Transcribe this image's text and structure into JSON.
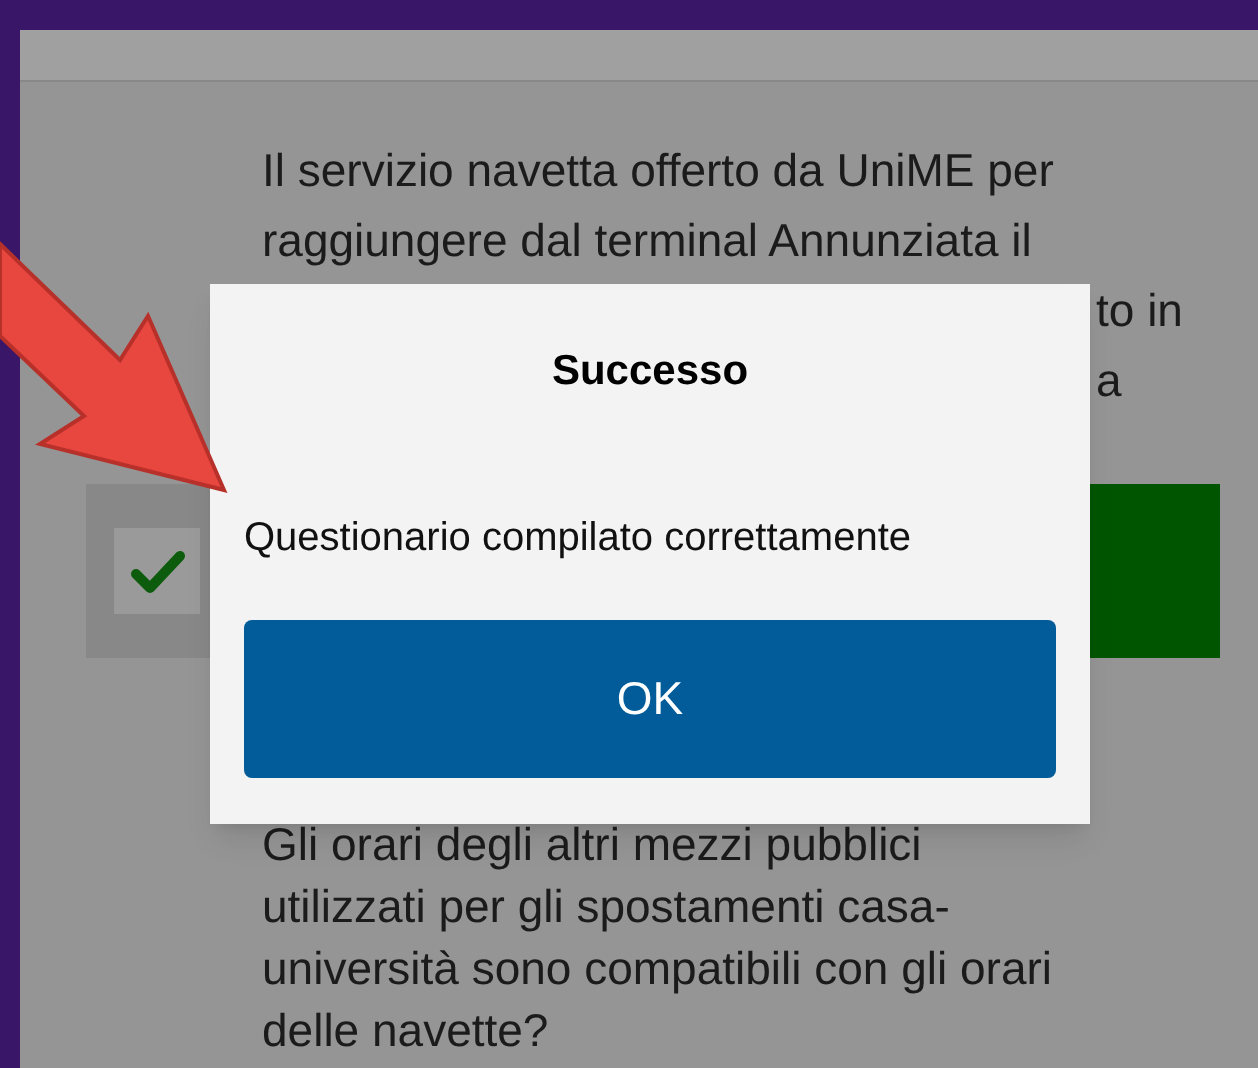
{
  "questions": [
    {
      "lines": [
        "Il servizio navetta offerto da UniME per",
        "raggiungere dal terminal Annunziata il"
      ],
      "fragments": [
        "to in",
        "a"
      ],
      "answer": {
        "checked": true
      }
    },
    {
      "lines": [
        "Gli orari degli altri mezzi pubblici",
        "utilizzati per gli spostamenti casa-",
        "università sono compatibili con gli orari",
        "delle navette?"
      ]
    }
  ],
  "dialog": {
    "title": "Successo",
    "message": "Questionario compilato correttamente",
    "button": "OK"
  }
}
